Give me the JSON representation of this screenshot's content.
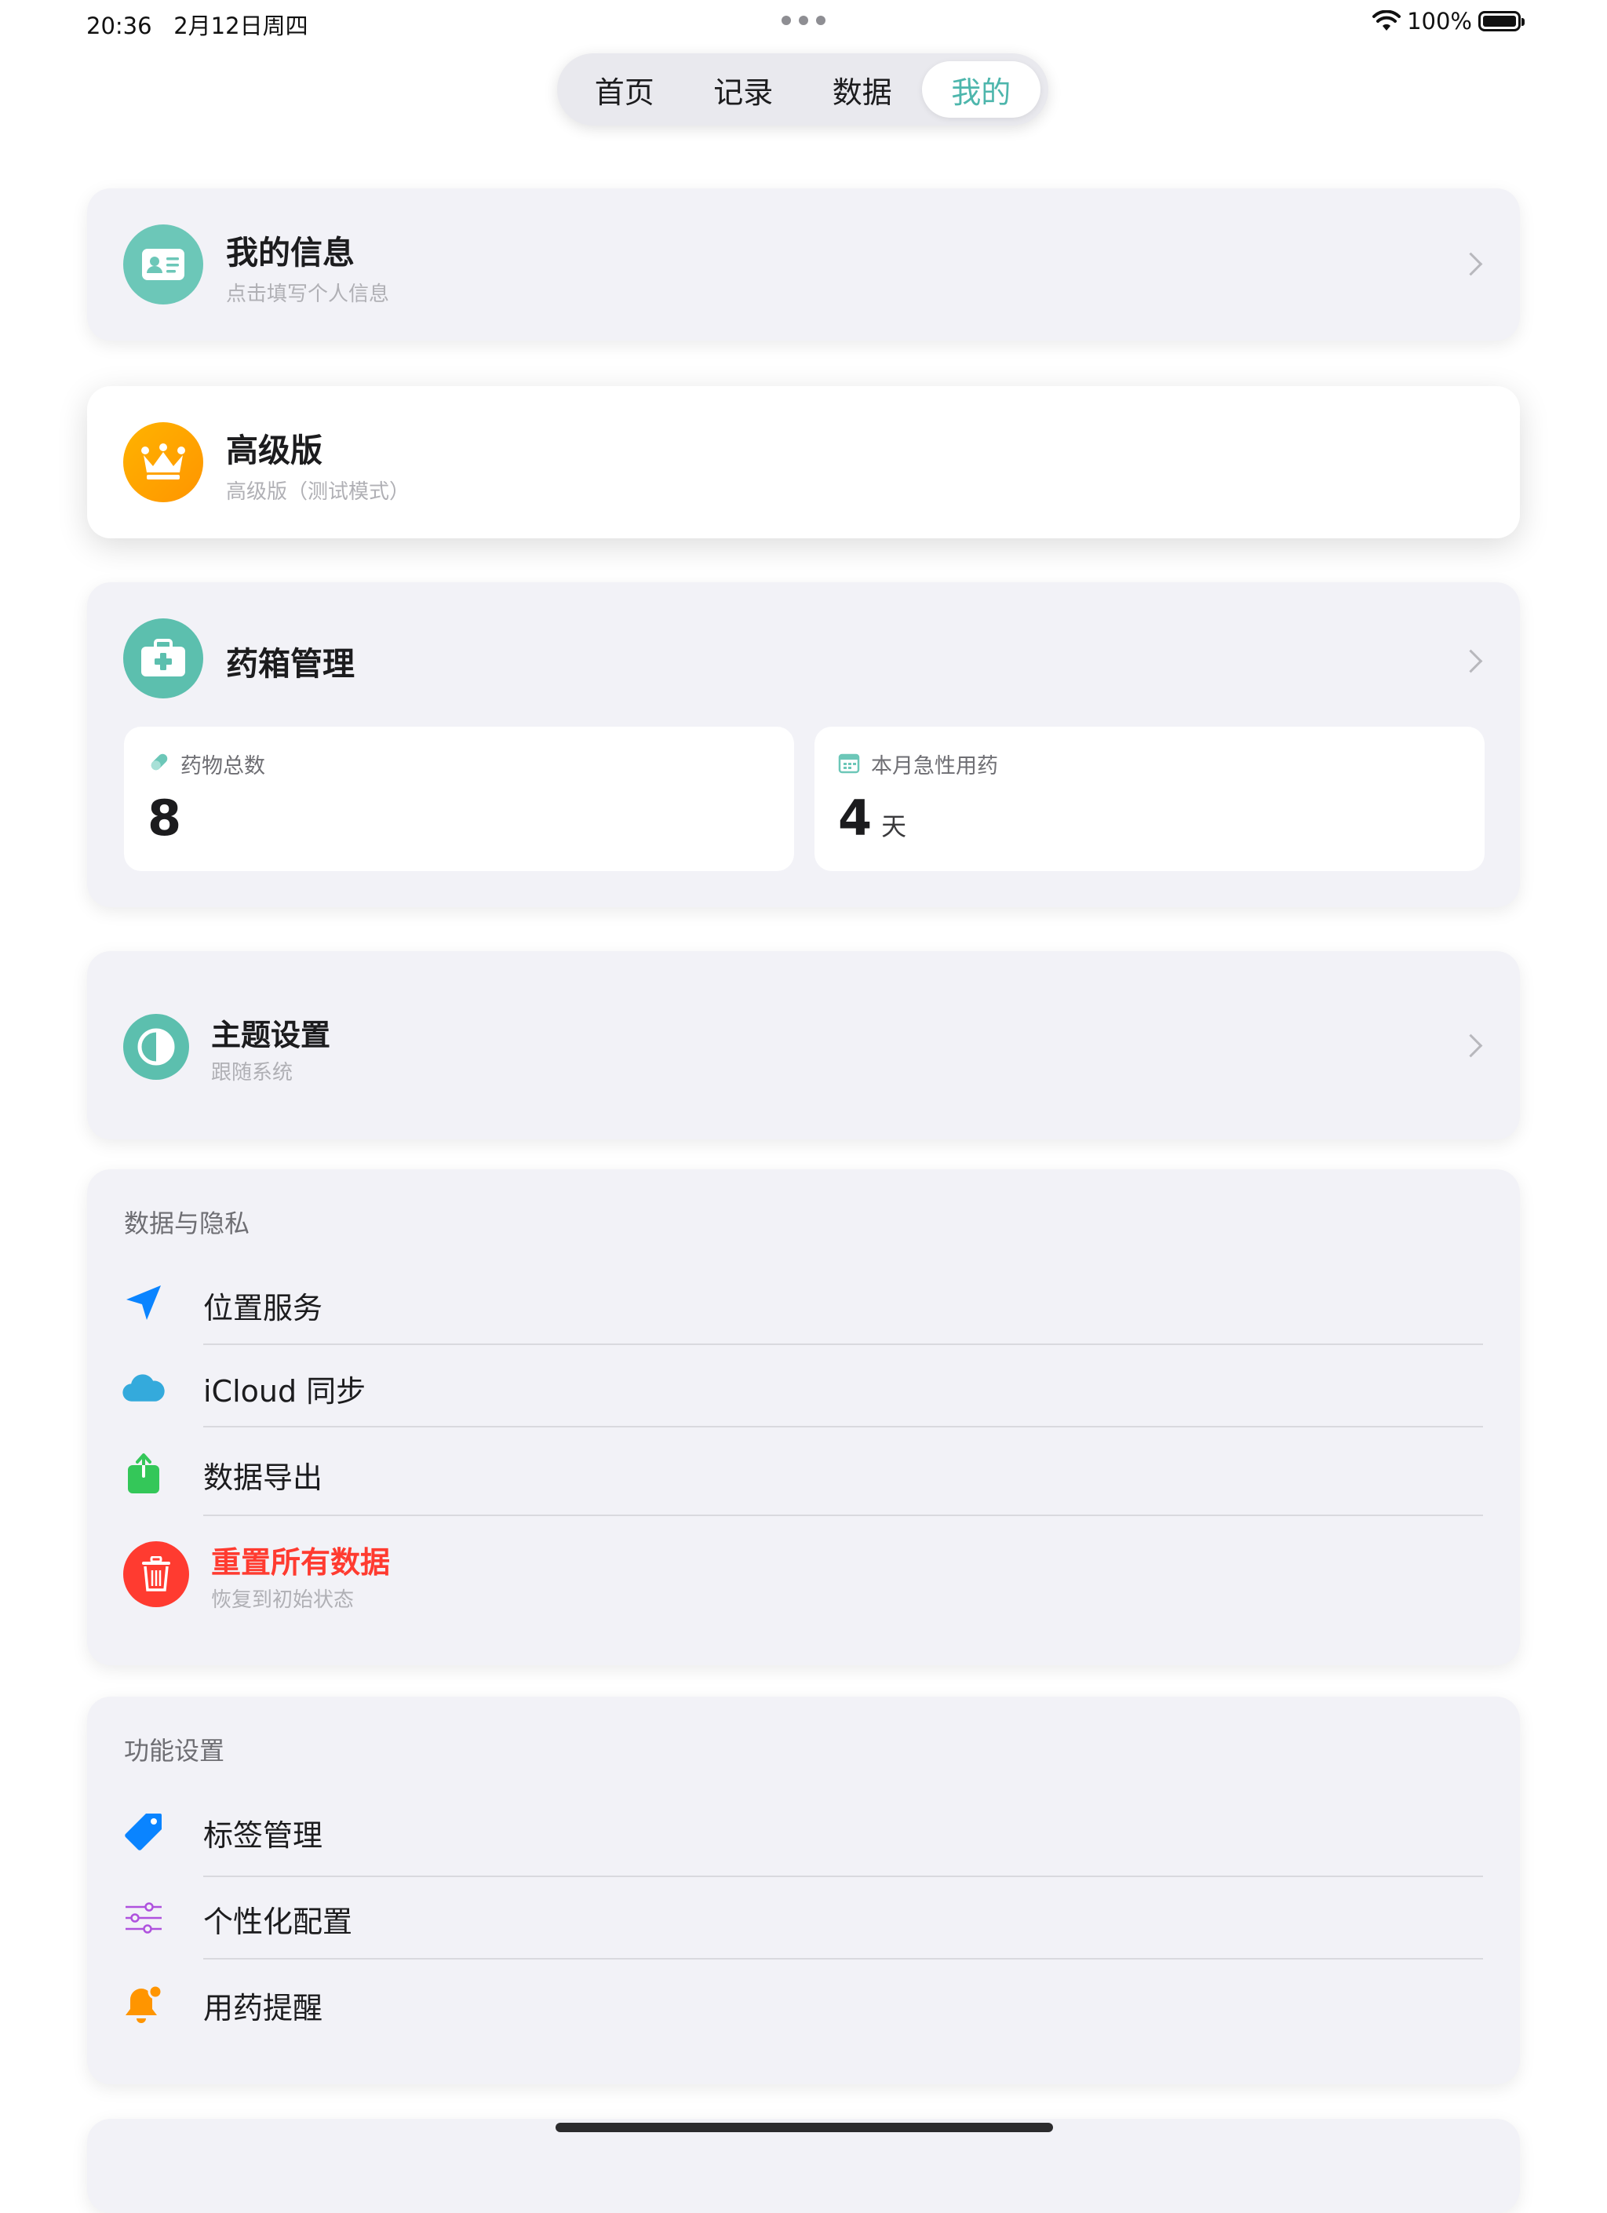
{
  "status": {
    "time": "20:36",
    "date": "2月12日周四",
    "battery": "100%"
  },
  "tabs": [
    {
      "label": "首页",
      "active": false
    },
    {
      "label": "记录",
      "active": false
    },
    {
      "label": "数据",
      "active": false
    },
    {
      "label": "我的",
      "active": true
    }
  ],
  "profile": {
    "title": "我的信息",
    "subtitle": "点击填写个人信息"
  },
  "premium": {
    "title": "高级版",
    "subtitle": "高级版（测试模式）"
  },
  "medicine_box": {
    "title": "药箱管理",
    "stats": [
      {
        "label": "药物总数",
        "value": "8",
        "unit": ""
      },
      {
        "label": "本月急性用药",
        "value": "4",
        "unit": "天"
      }
    ]
  },
  "theme": {
    "title": "主题设置",
    "subtitle": "跟随系统"
  },
  "privacy": {
    "header": "数据与隐私",
    "items": [
      {
        "label": "位置服务"
      },
      {
        "label": "iCloud 同步"
      },
      {
        "label": "数据导出"
      }
    ],
    "reset": {
      "title": "重置所有数据",
      "subtitle": "恢复到初始状态"
    }
  },
  "features": {
    "header": "功能设置",
    "items": [
      {
        "label": "标签管理"
      },
      {
        "label": "个性化配置"
      },
      {
        "label": "用药提醒"
      }
    ]
  },
  "colors": {
    "accent": "#4db6ac",
    "premium": "#ff9f0a",
    "danger": "#ff3b30",
    "location": "#0a84ff",
    "icloud": "#34aadc",
    "export": "#34c759",
    "tag": "#0a84ff",
    "config": "#af52de",
    "reminder": "#ff9500"
  }
}
